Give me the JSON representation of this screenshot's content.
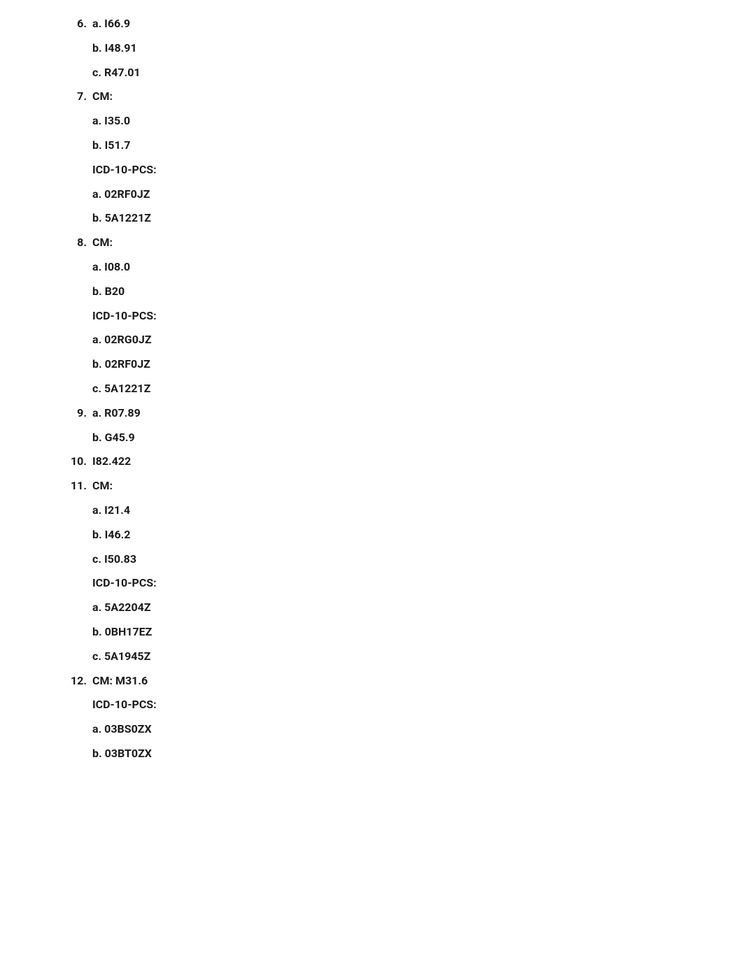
{
  "items": [
    {
      "number": 6,
      "lines": [
        "a. I66.9",
        "b. I48.91",
        "c. R47.01"
      ]
    },
    {
      "number": 7,
      "lines": [
        "CM:",
        "a. I35.0",
        "b. I51.7",
        "ICD-10-PCS:",
        "a. 02RF0JZ",
        "b. 5A1221Z"
      ]
    },
    {
      "number": 8,
      "lines": [
        "CM:",
        "a. I08.0",
        "b. B20",
        "ICD-10-PCS:",
        "a. 02RG0JZ",
        "b. 02RF0JZ",
        "c. 5A1221Z"
      ]
    },
    {
      "number": 9,
      "lines": [
        "a. R07.89",
        "b. G45.9"
      ]
    },
    {
      "number": 10,
      "lines": [
        "I82.422"
      ]
    },
    {
      "number": 11,
      "lines": [
        "CM:",
        "a. I21.4",
        "b. I46.2",
        "c. I50.83",
        "ICD-10-PCS:",
        "a. 5A2204Z",
        "b. 0BH17EZ",
        "c. 5A1945Z"
      ]
    },
    {
      "number": 12,
      "lines": [
        "CM: M31.6",
        "ICD-10-PCS:",
        "a. 03BS0ZX",
        "b. 03BT0ZX"
      ]
    }
  ]
}
